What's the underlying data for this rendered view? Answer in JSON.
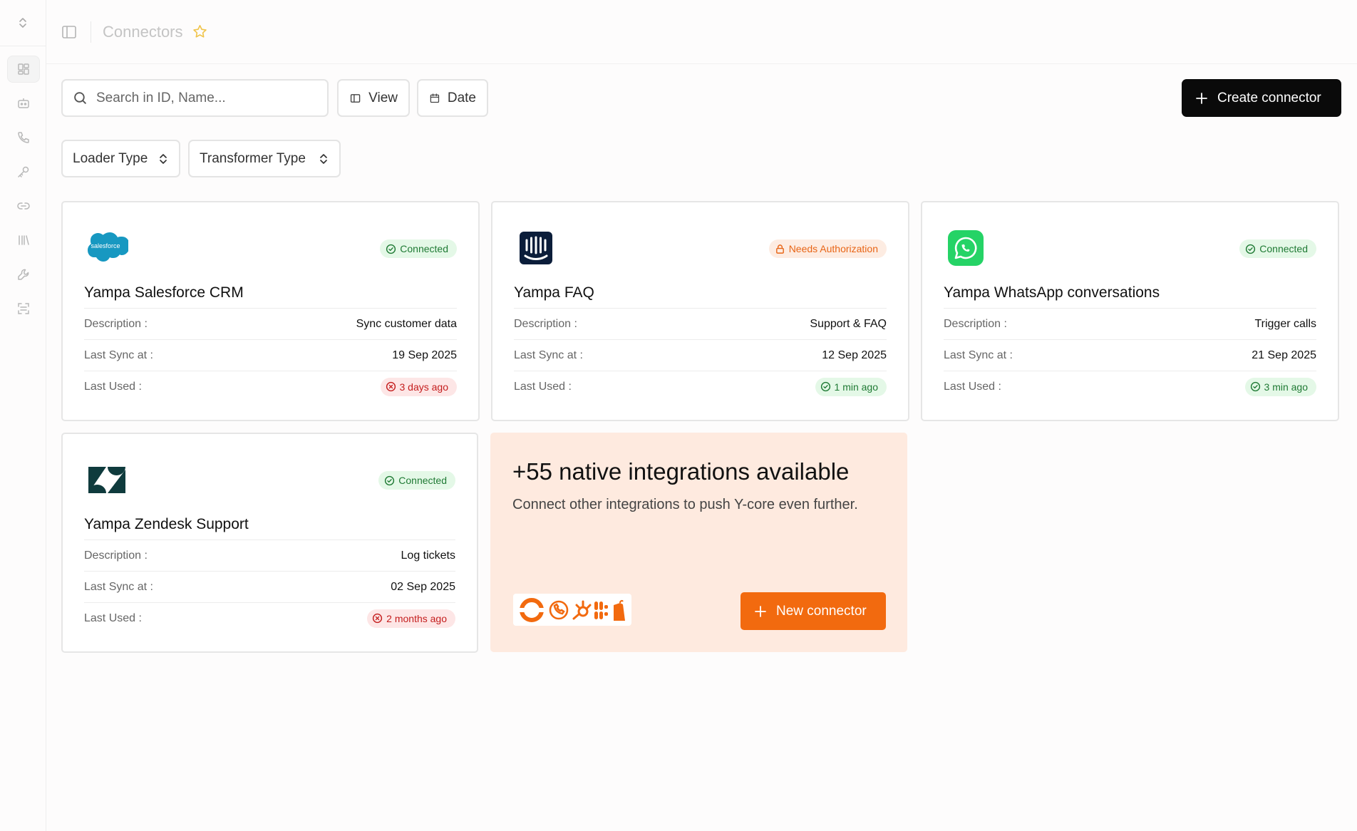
{
  "page": {
    "title": "Connectors"
  },
  "sidebar": {
    "toggle_icon": "chevron-up-down-icon",
    "items": [
      {
        "id": "dashboard",
        "icon": "grid-icon",
        "active": true
      },
      {
        "id": "bots",
        "icon": "bot-icon"
      },
      {
        "id": "calls",
        "icon": "phone-icon"
      },
      {
        "id": "keys",
        "icon": "key-icon"
      },
      {
        "id": "connectors",
        "icon": "link-icon"
      },
      {
        "id": "library",
        "icon": "library-icon"
      },
      {
        "id": "tools",
        "icon": "wrench-icon"
      },
      {
        "id": "scan",
        "icon": "scan-icon"
      }
    ]
  },
  "toolbar": {
    "search_placeholder": "Search in ID, Name...",
    "view_label": "View",
    "date_label": "Date",
    "create_label": "Create connector"
  },
  "filters": {
    "loader_label": "Loader Type",
    "transformer_label": "Transformer Type"
  },
  "labels": {
    "description": "Description :",
    "last_sync": "Last Sync at :",
    "last_used": "Last Used :"
  },
  "connectors": [
    {
      "name": "Yampa Salesforce CRM",
      "logo": "salesforce",
      "status": "Connected",
      "status_type": "ok",
      "description": "Sync customer data",
      "last_sync": "19 Sep 2025",
      "last_used": "3 days ago",
      "last_used_type": "bad"
    },
    {
      "name": "Yampa FAQ",
      "logo": "intercom",
      "status": "Needs Authorization",
      "status_type": "warn",
      "description": "Support & FAQ",
      "last_sync": "12 Sep 2025",
      "last_used": "1 min ago",
      "last_used_type": "ok"
    },
    {
      "name": "Yampa WhatsApp conversations",
      "logo": "whatsapp",
      "status": "Connected",
      "status_type": "ok",
      "description": "Trigger calls",
      "last_sync": "21 Sep 2025",
      "last_used": "3 min ago",
      "last_used_type": "ok"
    },
    {
      "name": "Yampa Zendesk Support",
      "logo": "zendesk",
      "status": "Connected",
      "status_type": "ok",
      "description": "Log tickets",
      "last_sync": "02 Sep 2025",
      "last_used": "2 months ago",
      "last_used_type": "bad"
    }
  ],
  "promo": {
    "heading": "+55 native integrations available",
    "subtext": "Connect other integrations to push Y-core even further.",
    "button_label": "New connector",
    "logos": [
      "circle-logo",
      "phone-logo",
      "hubspot-logo",
      "slack-logo",
      "shopify-logo"
    ]
  },
  "colors": {
    "accent": "#f26a0f",
    "primary": "#0a0a0a",
    "ok": "#1f7a34",
    "warn": "#e86516",
    "bad": "#c41d1d",
    "promo_bg": "#feeadf"
  }
}
